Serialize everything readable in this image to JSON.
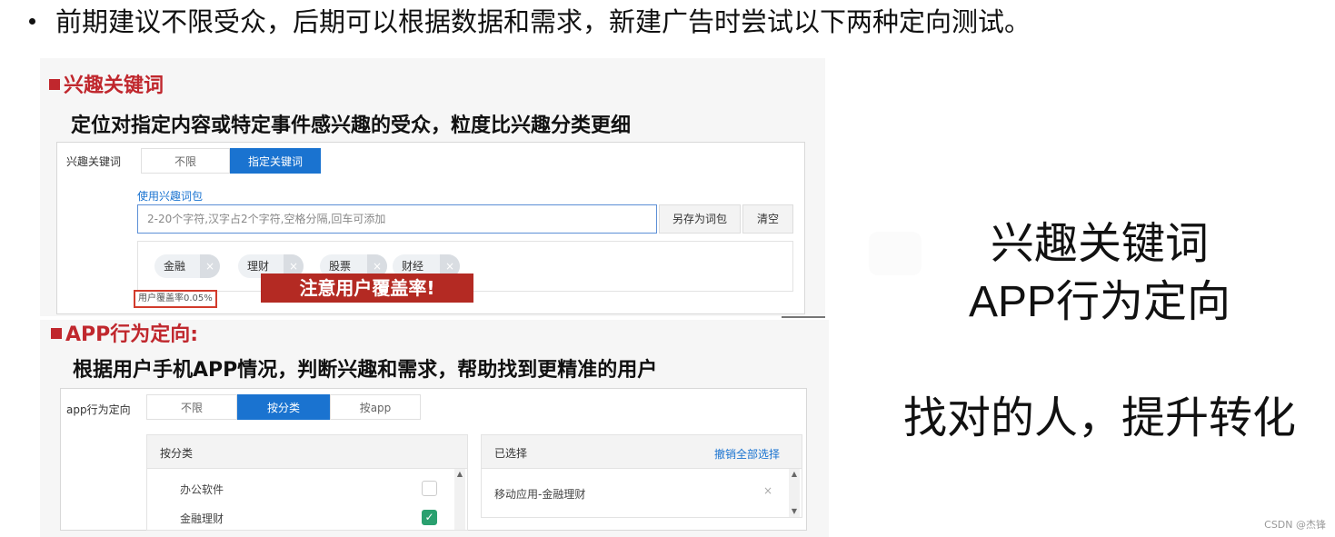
{
  "bullet_text": "前期建议不限受众，后期可以根据数据和需求，新建广告时尝试以下两种定向测试。",
  "section1": {
    "title": "兴趣关键词",
    "desc": "定位对指定内容或特定事件感兴趣的受众，粒度比兴趣分类更细",
    "field_label": "兴趣关键词",
    "tabs": [
      "不限",
      "指定关键词"
    ],
    "active_tab": "指定关键词",
    "pkg_label": "使用兴趣词包",
    "input_placeholder": "2-20个字符,汉字占2个字符,空格分隔,回车可添加",
    "save_btn": "另存为词包",
    "clear_btn": "清空",
    "tags": [
      "金融",
      "理财",
      "股票",
      "财经"
    ],
    "tag_close": "×",
    "coverage": "用户覆盖率0.05%",
    "warning": "注意用户覆盖率!"
  },
  "section2": {
    "title": "APP行为定向:",
    "desc": "根据用户手机APP情况，判断兴趣和需求，帮助找到更精准的用户",
    "field_label": "app行为定向",
    "tabs": [
      "不限",
      "按分类",
      "按app"
    ],
    "active_tab": "按分类",
    "category_header": "按分类",
    "categories": [
      {
        "label": "办公软件",
        "checked": false
      },
      {
        "label": "金融理财",
        "checked": true
      }
    ],
    "checkmark": "✓",
    "selected_header": "已选择",
    "clear_all": "撤销全部选择",
    "selected_items": [
      "移动应用-金融理财"
    ],
    "remove_icon": "×",
    "scroll_up": "▲",
    "scroll_down": "▼"
  },
  "right_text": {
    "line1": "兴趣关键词",
    "line2": "APP行为定向",
    "line3": "找对的人，提升转化"
  },
  "watermark": "CSDN @杰锋",
  "colors": {
    "accent_red": "#c0272d",
    "tab_blue": "#1a73d0",
    "check_green": "#2aa06f"
  }
}
